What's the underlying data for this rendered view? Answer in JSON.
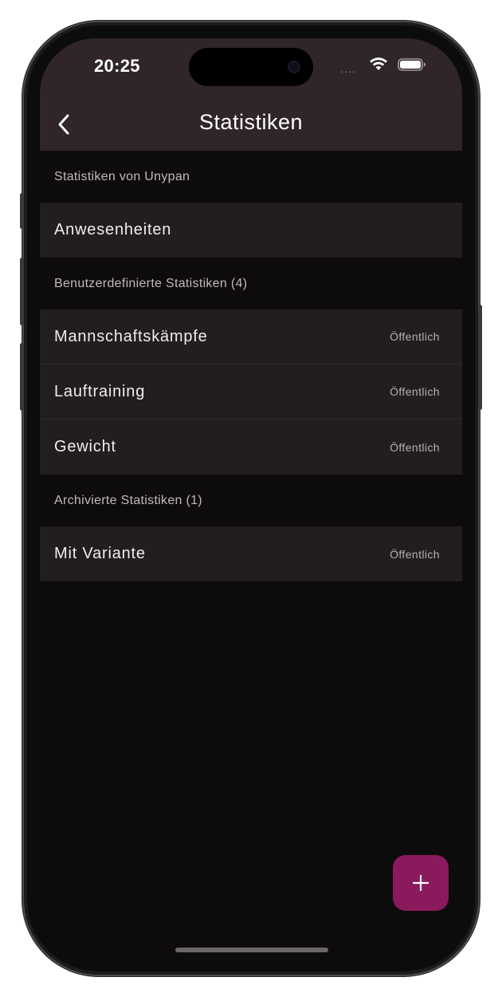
{
  "status_bar": {
    "time": "20:25",
    "signal": "...."
  },
  "nav": {
    "title": "Statistiken",
    "back_icon": "chevron-left-icon"
  },
  "sections": [
    {
      "header": "Statistiken von Unypan",
      "items": [
        {
          "label": "Anwesenheiten",
          "badge": ""
        }
      ]
    },
    {
      "header": "Benutzerdefinierte Statistiken (4)",
      "items": [
        {
          "label": "Mannschaftskämpfe",
          "badge": "Öffentlich"
        },
        {
          "label": "Lauftraining",
          "badge": "Öffentlich"
        },
        {
          "label": "Gewicht",
          "badge": "Öffentlich"
        }
      ]
    },
    {
      "header": "Archivierte Statistiken (1)",
      "items": [
        {
          "label": "Mit Variante",
          "badge": "Öffentlich"
        }
      ]
    }
  ],
  "fab": {
    "icon": "plus-icon"
  },
  "colors": {
    "topbar": "#2f252a",
    "background": "#0e0b0c",
    "row": "#221e20",
    "accent": "#8a1a5c"
  }
}
